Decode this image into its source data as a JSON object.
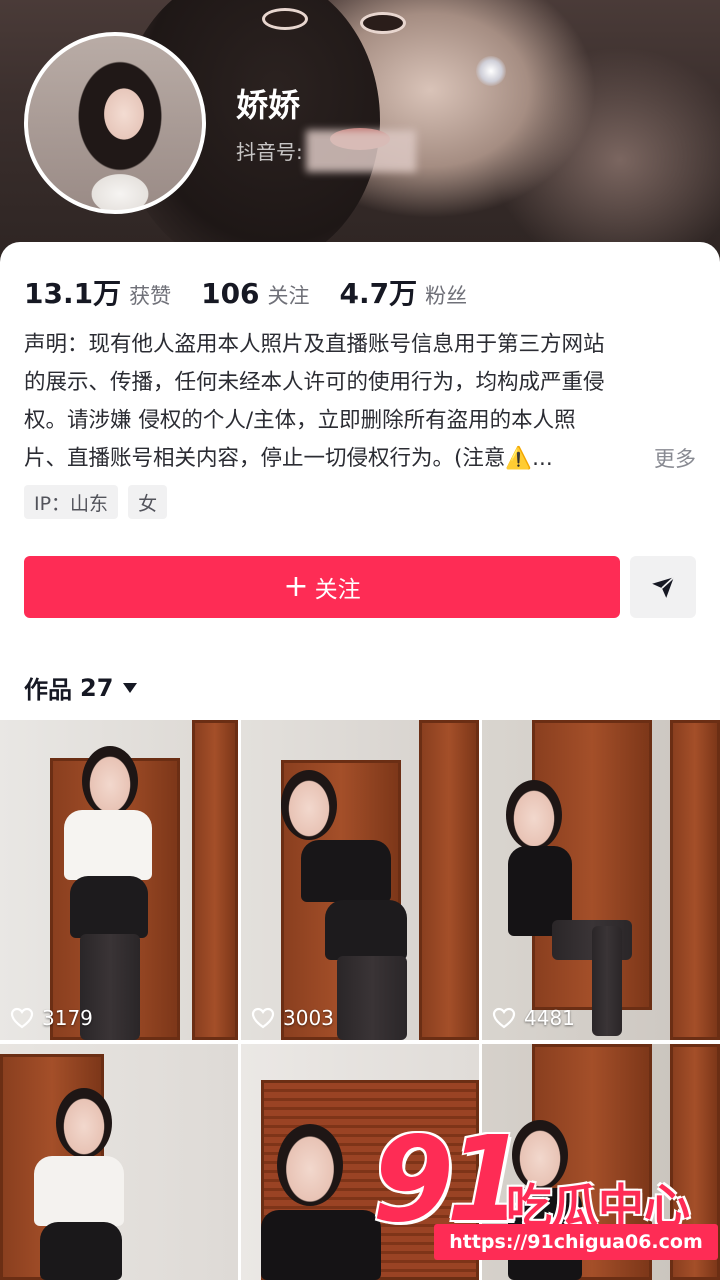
{
  "profile": {
    "name": "娇娇",
    "douyin_id_label": "抖音号:"
  },
  "stats": [
    {
      "value": "13.1万",
      "label": "获赞"
    },
    {
      "value": "106",
      "label": "关注"
    },
    {
      "value": "4.7万",
      "label": "粉丝"
    }
  ],
  "bio": {
    "lines": [
      "声明：现有他人盗用本人照片及直播账号信息用于第三方网站",
      "的展示、传播，任何未经本人许可的使用行为，均构成严重侵",
      "权。请涉嫌 侵权的个人/主体，立即删除所有盗用的本人照",
      "片、直播账号相关内容，停止一切侵权行为。(注意"
    ],
    "warning_glyph": "⚠️",
    "ellipsis": "...",
    "more": "更多"
  },
  "tags": [
    "IP：山东",
    "女"
  ],
  "actions": {
    "follow_plus": "+",
    "follow_label": "关注"
  },
  "works": {
    "label": "作品",
    "count": "27"
  },
  "videos": [
    {
      "likes": "3179"
    },
    {
      "likes": "3003"
    },
    {
      "likes": "4481"
    },
    {
      "likes": ""
    },
    {
      "likes": ""
    },
    {
      "likes": ""
    }
  ],
  "watermark": {
    "number": "91",
    "name": "吃瓜中心",
    "url": "https://91chigua06.com"
  },
  "colors": {
    "accent": "#fe2c55",
    "text": "#161823",
    "muted": "#6f7078"
  }
}
